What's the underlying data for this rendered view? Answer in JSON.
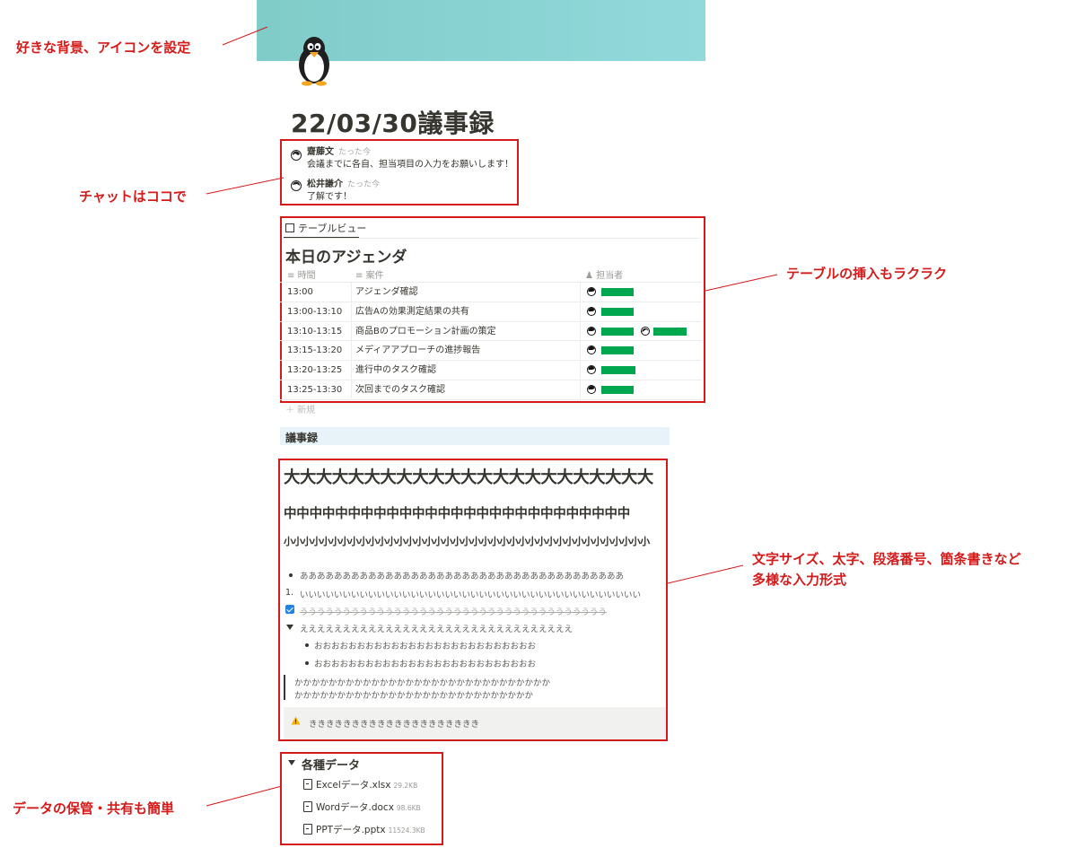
{
  "page": {
    "title": "22/03/30議事録"
  },
  "annotations": {
    "background_icon": "好きな背景、アイコンを設定",
    "chat": "チャットはココで",
    "table": "テーブルの挿入もラクラク",
    "text_formats_line1": "文字サイズ、太字、段落番号、箇条書きなど",
    "text_formats_line2": "多様な入力形式",
    "files": "データの保管・共有も簡単"
  },
  "chat": [
    {
      "name": "齋藤文",
      "time": "たった今",
      "text": "会議までに各自、担当項目の入力をお願いします！"
    },
    {
      "name": "松井謙介",
      "time": "たった今",
      "text": "了解です！"
    }
  ],
  "table": {
    "view_tab": "テーブルビュー",
    "title": "本日のアジェンダ",
    "columns": [
      "時間",
      "案件",
      "担当者"
    ],
    "rows": [
      {
        "time": "13:00",
        "item": "アジェンダ確認"
      },
      {
        "time": "13:00-13:10",
        "item": "広告Aの効果測定結果の共有"
      },
      {
        "time": "13:10-13:15",
        "item": "商品Bのプロモーション計画の策定"
      },
      {
        "time": "13:15-13:20",
        "item": "メディアアプローチの進捗報告"
      },
      {
        "time": "13:20-13:25",
        "item": "進行中のタスク確認"
      },
      {
        "time": "13:25-13:30",
        "item": "次回までのタスク確認"
      }
    ],
    "new_label": "＋ 新規",
    "redaction_color": "#00a74f"
  },
  "minutes": {
    "heading": "議事録",
    "h1": "大大大大大大大大大大大大大大大大大大大大大大大",
    "h2": "中中中中中中中中中中中中中中中中中中中中中中中中中中中",
    "h3": "小小小小小小小小小小小小小小小小小小小小小小小小小小小小小小小小小小小小小小小",
    "bullet": "ああああああああああああああああああああああああああああああああああああああ",
    "numbered_prefix": "1.",
    "numbered": "いいいいいいいいいいいいいいいいいいいいいいいいいいいいいいいいいいいいいいいい",
    "todo": "うううううううううううううううううううううううううううううううううううう",
    "toggle": "ええええええええええええええええええええええええええええええええ",
    "sub_bullet_1": "おおおおおおおおおおおおおおおおおおおおおおおおおお",
    "sub_bullet_2": "おおおおおおおおおおおおおおおおおおおおおおおおおお",
    "quote_1": "かかかかかかかかかかかかかかかかかかかかかかかかかかかかかか",
    "quote_2": "かかかかかかかかかかかかかかかかかかかかかかかかかかかか",
    "callout": "きききききききききききききききききききき"
  },
  "files": {
    "heading": "各種データ",
    "items": [
      {
        "name": "Excelデータ.xlsx",
        "size": "29.2KB"
      },
      {
        "name": "Wordデータ.docx",
        "size": "98.6KB"
      },
      {
        "name": "PPTデータ.pptx",
        "size": "11524.3KB"
      }
    ]
  },
  "colors": {
    "annotation_red": "#d51a1a",
    "cover": "#8bd3d3"
  }
}
